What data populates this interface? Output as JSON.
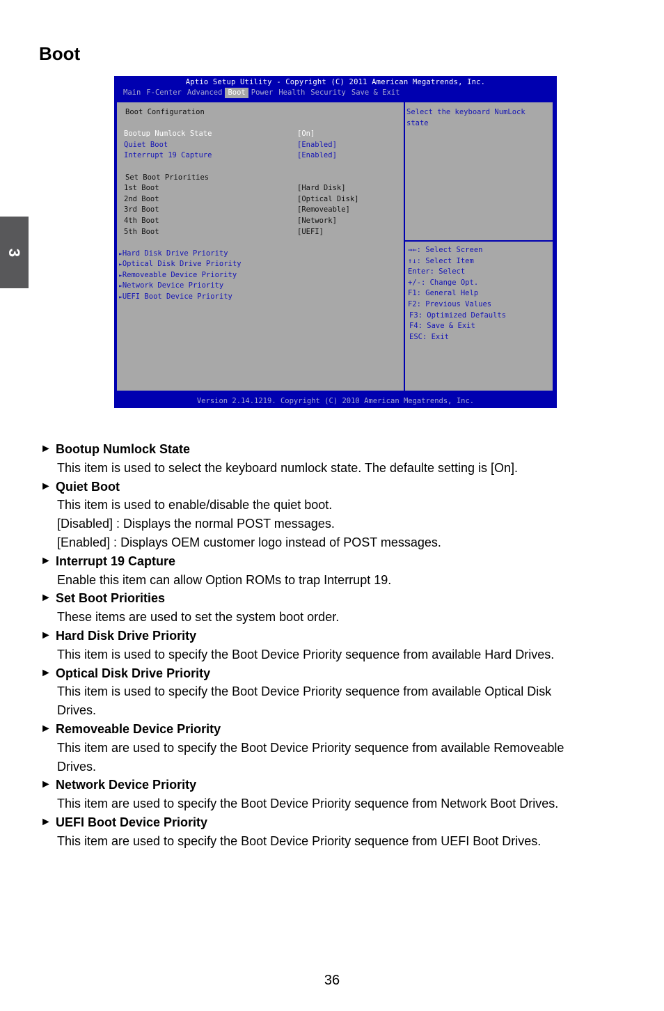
{
  "page": {
    "title": "Boot",
    "chapter_tab": "3",
    "page_number": "36"
  },
  "bios": {
    "title": "Aptio Setup Utility - Copyright (C) 2011 American Megatrends, Inc.",
    "tabs": [
      "Main",
      "F-Center",
      "Advanced",
      "Boot",
      "Power",
      "Health",
      "Security",
      "Save & Exit"
    ],
    "active_tab": "Boot",
    "section_header": "Boot Configuration",
    "settings": [
      {
        "label": "Bootup Numlock State",
        "value": "[On]",
        "state": "selected"
      },
      {
        "label": "Quiet Boot",
        "value": "[Enabled]",
        "state": "configurable"
      },
      {
        "label": "Interrupt 19 Capture",
        "value": "[Enabled]",
        "state": "configurable"
      }
    ],
    "priorities_header": "Set Boot Priorities",
    "boot_order": [
      {
        "label": "1st Boot",
        "value": "[Hard Disk]"
      },
      {
        "label": "2nd Boot",
        "value": "[Optical Disk]"
      },
      {
        "label": "3rd Boot",
        "value": "[Removeable]"
      },
      {
        "label": "4th Boot",
        "value": "[Network]"
      },
      {
        "label": "5th Boot",
        "value": "[UEFI]"
      }
    ],
    "submenu_arrow_icon": "►",
    "submenus": [
      "Hard Disk Drive Priority",
      "Optical Disk Drive Priority",
      "Removeable Device Priority",
      "Network Device Priority",
      "UEFI Boot Device Priority"
    ],
    "help_text": [
      "Select the keyboard NumLock",
      "state"
    ],
    "key_help": [
      "→←: Select Screen",
      "↑↓: Select Item",
      "Enter: Select",
      "+/-: Change Opt.",
      "F1: General Help",
      "F2: Previous Values",
      "F3: Optimized Defaults",
      "F4: Save & Exit",
      "ESC: Exit"
    ],
    "footer": "Version 2.14.1219. Copyright (C) 2010 American Megatrends, Inc.",
    "colors": {
      "frame_blue": "#0000b0",
      "panel_gray": "#a8a8a8",
      "text_blue": "#1414b4",
      "selected_white": "#ffffff"
    }
  },
  "doc_items": [
    {
      "title": "Bootup Numlock State",
      "lines": [
        "This item is used to select the keyboard numlock state. The defaulte setting is [On]."
      ]
    },
    {
      "title": "Quiet Boot",
      "lines": [
        "This item is used to enable/disable the quiet boot.",
        "[Disabled] : Displays the normal POST messages.",
        "[Enabled] : Displays OEM customer logo instead of POST messages."
      ]
    },
    {
      "title": "Interrupt 19 Capture",
      "lines": [
        "Enable this item can allow Option ROMs to trap Interrupt 19."
      ]
    },
    {
      "title": "Set Boot Priorities",
      "lines": [
        "These items are used to set the system boot order."
      ]
    },
    {
      "title": "Hard Disk Drive Priority",
      "lines": [
        "This item is used to specify the Boot Device Priority sequence from available Hard Drives."
      ]
    },
    {
      "title": "Optical Disk Drive Priority",
      "lines": [
        "This item is used to specify the Boot Device Priority sequence from available Optical Disk",
        "Drives."
      ]
    },
    {
      "title": "Removeable Device Priority",
      "lines": [
        "This item are used to specify the Boot Device Priority sequence from available Removeable",
        "Drives."
      ]
    },
    {
      "title": "Network Device Priority",
      "lines": [
        "This item are used to specify the Boot Device Priority sequence from Network Boot Drives."
      ]
    },
    {
      "title": "UEFI Boot Device Priority",
      "lines": [
        "This item are used to specify the Boot Device Priority sequence from UEFI Boot Drives."
      ]
    }
  ],
  "doc_bullet_icon": "►"
}
